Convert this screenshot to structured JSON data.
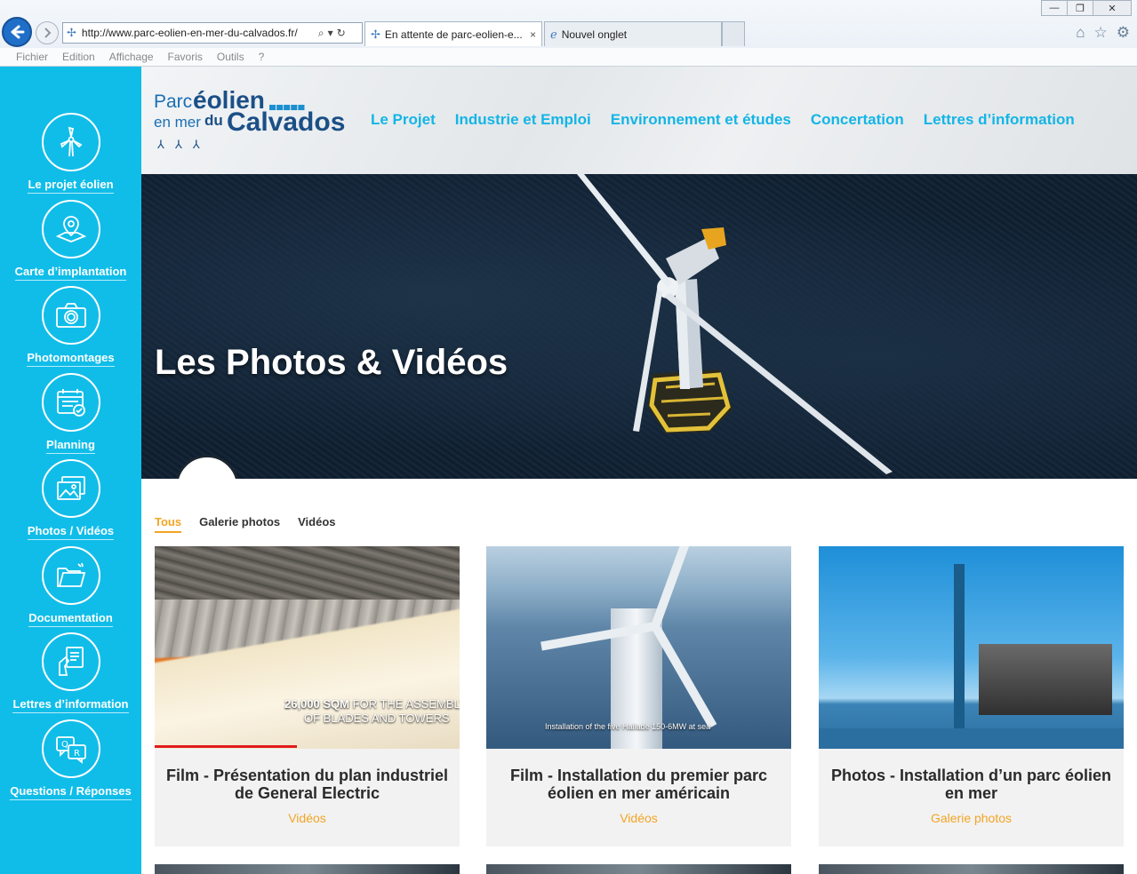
{
  "browser": {
    "url": "http://www.parc-eolien-en-mer-du-calvados.fr/",
    "tabs": [
      {
        "label": "En attente de parc-eolien-e...",
        "close": "×"
      },
      {
        "label": "Nouvel onglet"
      }
    ],
    "menu": [
      "Fichier",
      "Edition",
      "Affichage",
      "Favoris",
      "Outils",
      "?"
    ],
    "window_controls": {
      "minimize": "—",
      "restore": "❐",
      "close": "✕"
    }
  },
  "sidebar": {
    "items": [
      {
        "label": "Le projet éolien",
        "icon": "wind-turbine-icon"
      },
      {
        "label": "Carte d’implantation",
        "icon": "map-pin-icon"
      },
      {
        "label": "Photomontages",
        "icon": "camera-icon"
      },
      {
        "label": "Planning",
        "icon": "calendar-icon"
      },
      {
        "label": "Photos / Vidéos",
        "icon": "images-icon"
      },
      {
        "label": "Documentation",
        "icon": "folder-icon"
      },
      {
        "label": "Lettres d’information",
        "icon": "newsletter-icon"
      },
      {
        "label": "Questions / Réponses",
        "icon": "qa-bubbles-icon"
      }
    ],
    "color": "#10bde9"
  },
  "header": {
    "logo": {
      "line1a": "Parc",
      "line1b": "éolien",
      "line2a": "en mer",
      "line2b": "du",
      "line2c": "Calvados"
    },
    "nav": [
      "Le Projet",
      "Industrie et Emploi",
      "Environnement et études",
      "Concertation",
      "Lettres d’information"
    ]
  },
  "hero": {
    "title": "Les Photos & Vidéos"
  },
  "filters": {
    "items": [
      "Tous",
      "Galerie photos",
      "Vidéos"
    ],
    "active": "Tous",
    "accent": "#f3a524"
  },
  "cards": [
    {
      "title": "Film - Présentation du plan industriel de General Electric",
      "category": "Vidéos",
      "caption_bold": "26,000 SQM",
      "caption_rest": "FOR THE ASSEMBLY",
      "caption_line2": "OF BLADES AND TOWERS"
    },
    {
      "title": "Film - Installation du premier parc éolien en mer américain",
      "category": "Vidéos",
      "caption": "Installation of the five Haliade 150-6MW at sea"
    },
    {
      "title": "Photos - Installation d’un parc éolien en mer",
      "category": "Galerie photos"
    }
  ]
}
